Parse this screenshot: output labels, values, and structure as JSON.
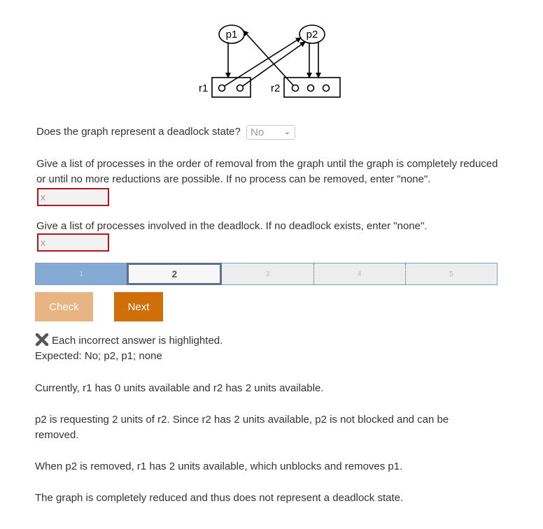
{
  "graph": {
    "processes": [
      "p1",
      "p2"
    ],
    "resources": [
      {
        "name": "r1",
        "units": 2
      },
      {
        "name": "r2",
        "units": 3
      }
    ]
  },
  "q1": {
    "text": "Does the graph represent a deadlock state?",
    "selected": "No"
  },
  "q2": {
    "text": "Give a list of processes in the order of removal from the graph until the graph is completely reduced or until no more reductions are possible. If no process can be removed, enter \"none\".",
    "value": "x"
  },
  "q3": {
    "text": "Give a list of processes involved in the deadlock. If no deadlock exists, enter \"none\".",
    "value": "x"
  },
  "progress": {
    "steps": [
      "1",
      "2",
      "3",
      "4",
      "5"
    ],
    "current": 2
  },
  "buttons": {
    "check": "Check",
    "next": "Next"
  },
  "feedback": {
    "incorrect": "Each incorrect answer is highlighted.",
    "expected": "Expected: No; p2, p1; none",
    "p1": "Currently, r1 has 0 units available and r2 has 2 units available.",
    "p2": "p2 is requesting 2 units of r2. Since r2 has 2 units available, p2 is not blocked and can be removed.",
    "p3": "When p2 is removed, r1 has 2 units available, which unblocks and removes p1.",
    "p4": "The graph is completely reduced and thus does not represent a deadlock state."
  },
  "icons": {
    "incorrect": "x-mark-icon",
    "dropdown": "chevron-down-icon"
  }
}
